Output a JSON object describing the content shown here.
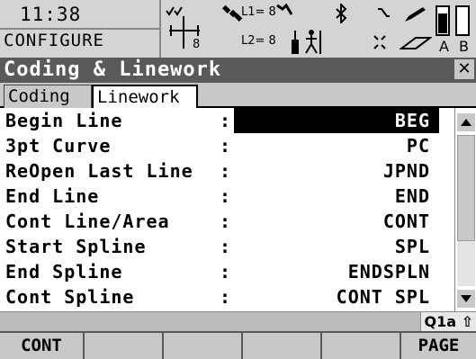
{
  "status": {
    "time": "11:38",
    "mode": "CONFIGURE",
    "l1_label": "L1= 8",
    "l2_label": "L2= 8",
    "gps_count": "8",
    "battery_a": "A",
    "battery_b": "B"
  },
  "window": {
    "title": "Coding & Linework",
    "close_glyph": "✕"
  },
  "tabs": [
    {
      "label": "Coding",
      "active": false
    },
    {
      "label": "Linework",
      "active": true
    }
  ],
  "form": {
    "rows": [
      {
        "label": "Begin Line",
        "value": "BEG",
        "selected": true
      },
      {
        "label": "3pt Curve",
        "value": "PC",
        "selected": false
      },
      {
        "label": "ReOpen Last Line",
        "value": "JPND",
        "selected": false
      },
      {
        "label": "End Line",
        "value": "END",
        "selected": false
      },
      {
        "label": "Cont Line/Area",
        "value": "CONT",
        "selected": false
      },
      {
        "label": "Start Spline",
        "value": "SPL",
        "selected": false
      },
      {
        "label": "End Spline",
        "value": "ENDSPLN",
        "selected": false
      },
      {
        "label": "Cont Spline",
        "value": "CONT SPL",
        "selected": false
      }
    ],
    "colon": ":"
  },
  "infobar": {
    "input_mode": "Q1a ⇧"
  },
  "softkeys": {
    "f1": "CONT",
    "f2": "",
    "f3": "",
    "f4": "",
    "f5": "",
    "f6": "PAGE"
  }
}
